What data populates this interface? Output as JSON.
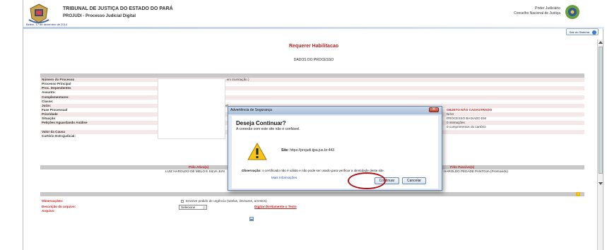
{
  "header": {
    "tribunal": "TRIBUNAL DE JUSTIÇA DO ESTADO DO PARÁ",
    "system": "PROJUDI - Processo Judicial Digital",
    "date": "Belém, 17 de dezembro de 2014",
    "poder": "Poder Judiciário",
    "cnj": "Conselho Nacional de Justiça",
    "sair_label": "Sair do Sistema"
  },
  "page": {
    "title": "Requerer Habilitacao",
    "subtitle": "DADOS DO PROCESSO"
  },
  "process_fields": [
    {
      "label": "Número do Processo",
      "value": "s em tramitação )",
      "value2": ""
    },
    {
      "label": "Processo Principal",
      "value": "",
      "value2": ""
    },
    {
      "label": "Proc. Dependentes",
      "value": "",
      "value2": ""
    },
    {
      "label": "Assunto:",
      "value": "",
      "value2": ""
    },
    {
      "label": "Complementares:",
      "value": "",
      "value2": ""
    },
    {
      "label": "Classe:",
      "value": "",
      "value2": ""
    },
    {
      "label": "Juízo:",
      "value": "bel",
      "value2": ""
    },
    {
      "label": "Fase Processual",
      "value": "",
      "value2": "OBJETO NÃO CADASTRADO"
    },
    {
      "label": "Prioridade",
      "value": "",
      "value2": "NÃO"
    },
    {
      "label": "Situação",
      "value": "",
      "value2": "PROCESSO BAIXADO EM"
    },
    {
      "label": "Petições Aguardando Análise",
      "value": "",
      "value2": "0 intimações"
    },
    {
      "label": "",
      "value": "",
      "value2": "0 cumprimentos do cartório"
    },
    {
      "label": "Valor da Causa",
      "value": "",
      "value2": ""
    },
    {
      "label": "Cartório Extrajudicial:",
      "value": "",
      "value2": ""
    }
  ],
  "polos": {
    "ativo_label": "Pólo Ativo(s)",
    "passivo_label": "Pólo Passivo(s)",
    "ativo_name": "LUIZ HAROLDO DE MELO E SILVA JUN",
    "passivo_name": "HAROLDO PEDADE PANTOJA (Promovido)"
  },
  "form": {
    "observacoes_label": "Observações:",
    "urgencia_label": "Envolve pedido de urgência (tutelas, liminares, arrestos)",
    "descricao_label": "Descrição do arquivo:",
    "select_value": "Selecione",
    "digitar_label": "Digitar Diretamente o Texto",
    "arquivo_label": "Arquivo:",
    "help_icon": "?"
  },
  "dialog": {
    "title": "Advertência de Segurança",
    "close_glyph": "✕",
    "heading": "Deseja Continuar?",
    "subheading": "A conexão com este site não é confiável.",
    "site_label": "Site:",
    "site_value": "https://projudi.tjpa.jus.br:443",
    "obs_label": "Observação:",
    "obs_text": "o certificado não é válido e não pode ser usado para verificar a identidade deste site.",
    "more_info": "Mais Informações",
    "continue_label": "Continuar",
    "cancel_label": "Cancelar"
  },
  "colors": {
    "accent_red": "#b22222",
    "highlight_ring": "#b01515",
    "dialog_blue": "#6a86a8"
  }
}
